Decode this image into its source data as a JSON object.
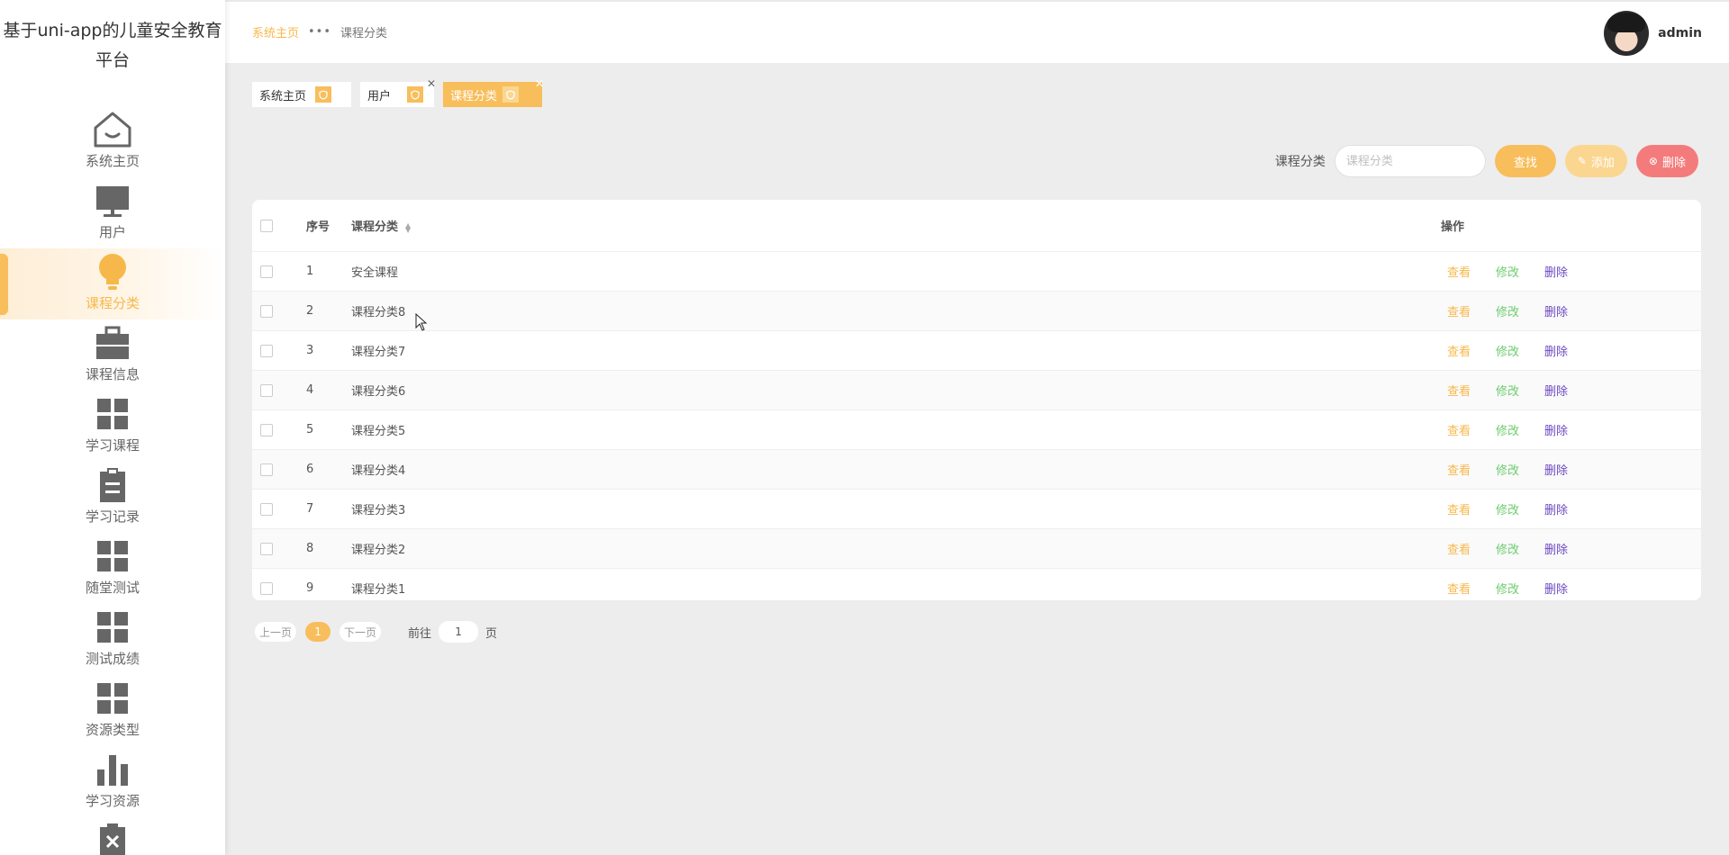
{
  "app": {
    "title": "基于uni-app的儿童安全教育平台"
  },
  "sidebar": {
    "items": [
      {
        "label": "系统主页",
        "icon": "house-icon"
      },
      {
        "label": "用户",
        "icon": "monitor-icon"
      },
      {
        "label": "课程分类",
        "icon": "bulb-icon",
        "active": true
      },
      {
        "label": "课程信息",
        "icon": "briefcase-icon"
      },
      {
        "label": "学习课程",
        "icon": "grid-icon"
      },
      {
        "label": "学习记录",
        "icon": "clipboard-icon"
      },
      {
        "label": "随堂测试",
        "icon": "grid-icon"
      },
      {
        "label": "测试成绩",
        "icon": "grid-icon"
      },
      {
        "label": "资源类型",
        "icon": "grid-icon"
      },
      {
        "label": "学习资源",
        "icon": "bar-chart-icon"
      }
    ]
  },
  "header": {
    "breadcrumb": {
      "home": "系统主页",
      "separator": "•••",
      "current": "课程分类"
    },
    "user": {
      "name": "admin"
    }
  },
  "tags": [
    {
      "label": "系统主页",
      "closable": false
    },
    {
      "label": "用户",
      "closable": true
    },
    {
      "label": "课程分类",
      "closable": true,
      "active": true
    }
  ],
  "search": {
    "label": "课程分类",
    "placeholder": "课程分类",
    "value": "",
    "search_button": "查找",
    "add_button": "添加",
    "delete_button": "删除"
  },
  "table": {
    "columns": {
      "no": "序号",
      "name": "课程分类",
      "ops": "操作"
    },
    "rows": [
      {
        "no": "1",
        "name": "安全课程"
      },
      {
        "no": "2",
        "name": "课程分类8"
      },
      {
        "no": "3",
        "name": "课程分类7"
      },
      {
        "no": "4",
        "name": "课程分类6"
      },
      {
        "no": "5",
        "name": "课程分类5"
      },
      {
        "no": "6",
        "name": "课程分类4"
      },
      {
        "no": "7",
        "name": "课程分类3"
      },
      {
        "no": "8",
        "name": "课程分类2"
      },
      {
        "no": "9",
        "name": "课程分类1"
      }
    ],
    "row_actions": {
      "view": "查看",
      "edit": "修改",
      "delete": "删除"
    }
  },
  "pagination": {
    "prev": "上一页",
    "current": "1",
    "next": "下一页",
    "goto_label": "前往",
    "goto_value": "1",
    "goto_unit": "页"
  },
  "colors": {
    "accent": "#f8be5b",
    "view": "#f7b84b",
    "edit": "#6ccc6c",
    "delete_link": "#6b48c2",
    "delete_button": "#f47b7b"
  }
}
